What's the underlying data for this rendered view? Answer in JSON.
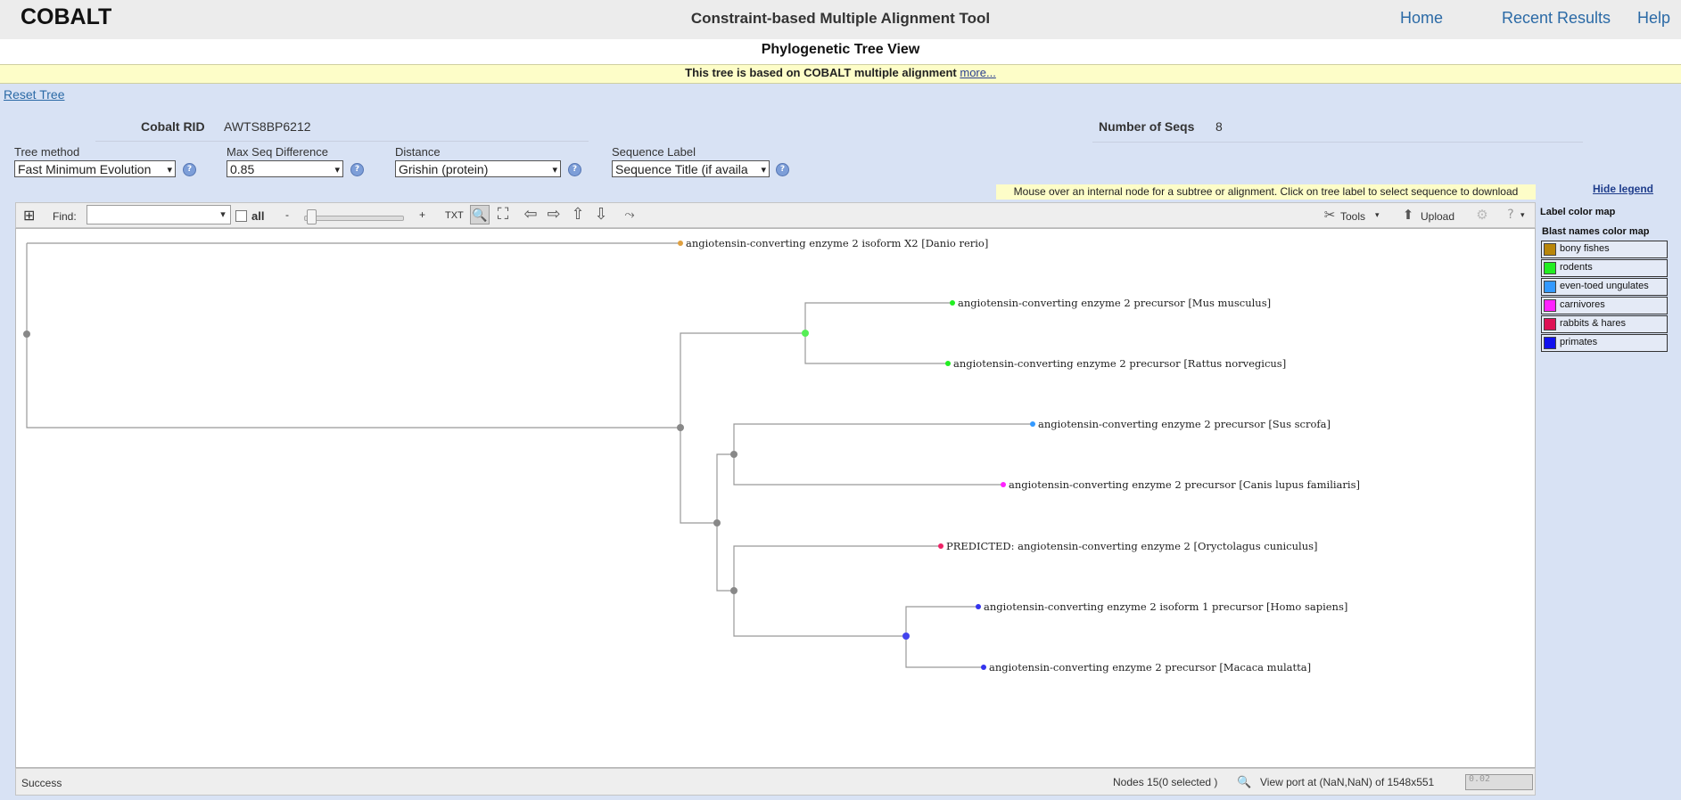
{
  "header": {
    "logo": "COBALT",
    "title": "Constraint-based Multiple Alignment Tool",
    "nav": [
      "Home",
      "Recent Results",
      "Help"
    ]
  },
  "view_title": "Phylogenetic Tree View",
  "notice": {
    "text": "This tree is based on COBALT multiple alignment",
    "link": "more..."
  },
  "reset_tree": "Reset Tree",
  "info": {
    "rid_label": "Cobalt RID",
    "rid_value": "AWTS8BP6212",
    "nseq_label": "Number of Seqs",
    "nseq_value": "8"
  },
  "options": {
    "tree_method": {
      "label": "Tree method",
      "value": "Fast Minimum Evolution"
    },
    "max_seq_diff": {
      "label": "Max Seq Difference",
      "value": "0.85"
    },
    "distance": {
      "label": "Distance",
      "value": "Grishin (protein)"
    },
    "sequence_label": {
      "label": "Sequence Label",
      "value": "Sequence Title (if availa"
    }
  },
  "hint": "Mouse over an internal node for a subtree or alignment. Click on tree label to select sequence to download",
  "hide_legend": "Hide legend",
  "toolbar": {
    "expand": "⊞",
    "find_label": "Find:",
    "find_value": "",
    "all_label": "all",
    "zoom_minus": "-",
    "zoom_plus": "+",
    "txt": "TXT",
    "tools": "Tools",
    "upload": "Upload"
  },
  "legend": {
    "title": "Label color map",
    "subtitle": "Blast names color map",
    "items": [
      {
        "label": "bony fishes",
        "color": "#b8860b"
      },
      {
        "label": "rodents",
        "color": "#22ee22"
      },
      {
        "label": "even-toed ungulates",
        "color": "#3399ff"
      },
      {
        "label": "carnivores",
        "color": "#ff22ff"
      },
      {
        "label": "rabbits & hares",
        "color": "#dd1155"
      },
      {
        "label": "primates",
        "color": "#1111ee"
      }
    ]
  },
  "tree": {
    "leaves": [
      {
        "label": "angiotensin-converting enzyme 2 isoform X2 [Danio rerio]",
        "color": "#e0a040"
      },
      {
        "label": "angiotensin-converting enzyme 2 precursor [Mus musculus]",
        "color": "#22ee22"
      },
      {
        "label": "angiotensin-converting enzyme 2 precursor [Rattus norvegicus]",
        "color": "#22ee22"
      },
      {
        "label": "angiotensin-converting enzyme 2 precursor [Sus scrofa]",
        "color": "#3399ff"
      },
      {
        "label": "angiotensin-converting enzyme 2 precursor [Canis lupus familiaris]",
        "color": "#ff22ff"
      },
      {
        "label": "PREDICTED: angiotensin-converting enzyme 2 [Oryctolagus cuniculus]",
        "color": "#ee2266"
      },
      {
        "label": "angiotensin-converting enzyme 2 isoform 1 precursor [Homo sapiens]",
        "color": "#3333ee"
      },
      {
        "label": "angiotensin-converting enzyme 2 precursor [Macaca mulatta]",
        "color": "#3333ee"
      }
    ]
  },
  "status": {
    "text": "Success",
    "nodes": "Nodes 15(0 selected )",
    "viewport": "View port at (NaN,NaN)   of 1548x551",
    "zoom": "0.02"
  }
}
